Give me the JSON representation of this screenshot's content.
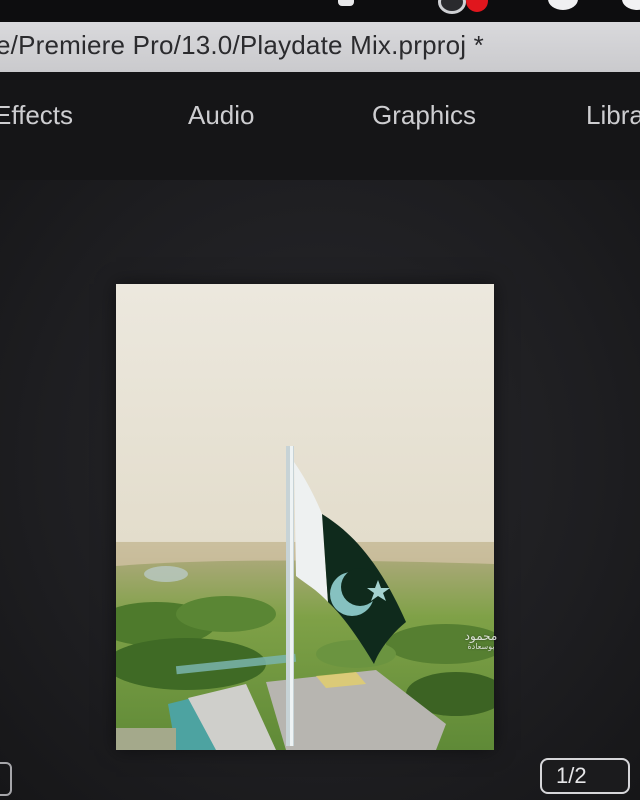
{
  "window": {
    "title": "e/Premiere Pro/13.0/Playdate Mix.prproj *"
  },
  "workspace_tabs": [
    {
      "label": "Effects"
    },
    {
      "label": "Audio"
    },
    {
      "label": "Graphics"
    },
    {
      "label": "Libra"
    }
  ],
  "system_bar": {
    "icons": [
      "notification-icon",
      "control-center-icon",
      "record-icon",
      "wifi-icon",
      "battery-icon"
    ]
  },
  "program_monitor": {
    "watermark_main": "محمود",
    "watermark_sub": "بوسعادة",
    "page_indicator": "1/2",
    "scene": {
      "flag_colors": {
        "green": "#0e2a1c",
        "white": "#e9eef0",
        "emblem": "#7fb8b8"
      },
      "sky": "#e8e3d6",
      "vegetation": "#6f9c3e"
    }
  },
  "colors": {
    "title_bar": "#d1d1d4",
    "tab_bar": "#151517",
    "monitor_bg": "#222225",
    "record_dot": "#e0161d"
  }
}
